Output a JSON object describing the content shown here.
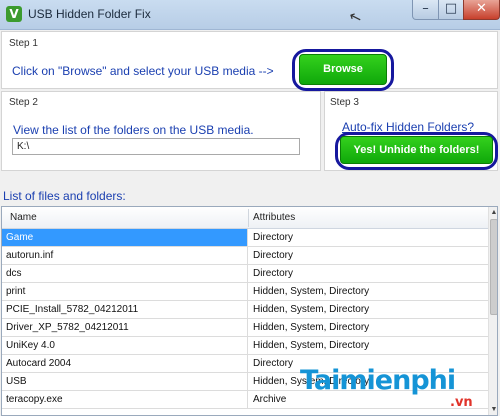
{
  "window": {
    "title": "USB Hidden Folder Fix",
    "app_icon": "V",
    "min_glyph": "–",
    "max_glyph": "□",
    "close_glyph": "✕",
    "cursor_glyph": "↖"
  },
  "step1": {
    "label": "Step 1",
    "instruction": "Click on \"Browse\" and select your USB media -->",
    "browse_label": "Browse"
  },
  "step2": {
    "label": "Step 2",
    "instruction": "View the list of the folders on the USB media.",
    "path_value": "K:\\"
  },
  "step3": {
    "label": "Step 3",
    "heading": "Auto-fix Hidden Folders?",
    "unhide_label": "Yes! Unhide the folders!"
  },
  "list": {
    "caption": "List of files and folders:",
    "columns": [
      "Name",
      "Attributes"
    ],
    "rows": [
      {
        "name": "Game",
        "attr": "Directory"
      },
      {
        "name": "autorun.inf",
        "attr": "Directory"
      },
      {
        "name": "dcs",
        "attr": "Directory"
      },
      {
        "name": "print",
        "attr": "Hidden, System, Directory"
      },
      {
        "name": "PCIE_Install_5782_04212011",
        "attr": "Hidden, System, Directory"
      },
      {
        "name": "Driver_XP_5782_04212011",
        "attr": "Hidden, System, Directory"
      },
      {
        "name": "UniKey 4.0",
        "attr": "Hidden, System, Directory"
      },
      {
        "name": "Autocard 2004",
        "attr": "Directory"
      },
      {
        "name": "USB",
        "attr": "Hidden, System, Directory"
      },
      {
        "name": "teracopy.exe",
        "attr": "Archive"
      }
    ],
    "selected_index": 0
  },
  "watermark": {
    "logo": "Taimienphi",
    "tld": ".vn"
  },
  "colors": {
    "accent_blue": "#1a3fb0",
    "button_green": "#19b40f",
    "selection": "#3399ff",
    "ring": "#16189e"
  }
}
